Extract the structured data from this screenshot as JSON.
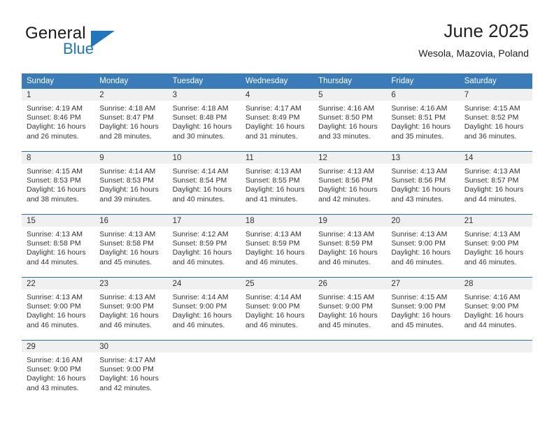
{
  "brand": {
    "name_primary": "General",
    "name_secondary": "Blue",
    "flag_icon": "triangle-flag-icon",
    "accent_color": "#1f76bc"
  },
  "header": {
    "title": "June 2025",
    "location": "Wesola, Mazovia, Poland"
  },
  "theme": {
    "header_row_background": "#3a7cba",
    "header_row_text": "#ffffff",
    "week_divider_color": "#2c6fb0",
    "daynumber_band_background": "#f0f0f0",
    "cell_background": "#ffffff",
    "body_text": "#333333"
  },
  "weekday_headers": [
    "Sunday",
    "Monday",
    "Tuesday",
    "Wednesday",
    "Thursday",
    "Friday",
    "Saturday"
  ],
  "labels": {
    "sunrise_prefix": "Sunrise:",
    "sunset_prefix": "Sunset:",
    "daylight_prefix": "Daylight:"
  },
  "weeks": [
    [
      {
        "day": "1",
        "sunrise": "Sunrise: 4:19 AM",
        "sunset": "Sunset: 8:46 PM",
        "daylight": "Daylight: 16 hours and 26 minutes."
      },
      {
        "day": "2",
        "sunrise": "Sunrise: 4:18 AM",
        "sunset": "Sunset: 8:47 PM",
        "daylight": "Daylight: 16 hours and 28 minutes."
      },
      {
        "day": "3",
        "sunrise": "Sunrise: 4:18 AM",
        "sunset": "Sunset: 8:48 PM",
        "daylight": "Daylight: 16 hours and 30 minutes."
      },
      {
        "day": "4",
        "sunrise": "Sunrise: 4:17 AM",
        "sunset": "Sunset: 8:49 PM",
        "daylight": "Daylight: 16 hours and 31 minutes."
      },
      {
        "day": "5",
        "sunrise": "Sunrise: 4:16 AM",
        "sunset": "Sunset: 8:50 PM",
        "daylight": "Daylight: 16 hours and 33 minutes."
      },
      {
        "day": "6",
        "sunrise": "Sunrise: 4:16 AM",
        "sunset": "Sunset: 8:51 PM",
        "daylight": "Daylight: 16 hours and 35 minutes."
      },
      {
        "day": "7",
        "sunrise": "Sunrise: 4:15 AM",
        "sunset": "Sunset: 8:52 PM",
        "daylight": "Daylight: 16 hours and 36 minutes."
      }
    ],
    [
      {
        "day": "8",
        "sunrise": "Sunrise: 4:15 AM",
        "sunset": "Sunset: 8:53 PM",
        "daylight": "Daylight: 16 hours and 38 minutes."
      },
      {
        "day": "9",
        "sunrise": "Sunrise: 4:14 AM",
        "sunset": "Sunset: 8:53 PM",
        "daylight": "Daylight: 16 hours and 39 minutes."
      },
      {
        "day": "10",
        "sunrise": "Sunrise: 4:14 AM",
        "sunset": "Sunset: 8:54 PM",
        "daylight": "Daylight: 16 hours and 40 minutes."
      },
      {
        "day": "11",
        "sunrise": "Sunrise: 4:13 AM",
        "sunset": "Sunset: 8:55 PM",
        "daylight": "Daylight: 16 hours and 41 minutes."
      },
      {
        "day": "12",
        "sunrise": "Sunrise: 4:13 AM",
        "sunset": "Sunset: 8:56 PM",
        "daylight": "Daylight: 16 hours and 42 minutes."
      },
      {
        "day": "13",
        "sunrise": "Sunrise: 4:13 AM",
        "sunset": "Sunset: 8:56 PM",
        "daylight": "Daylight: 16 hours and 43 minutes."
      },
      {
        "day": "14",
        "sunrise": "Sunrise: 4:13 AM",
        "sunset": "Sunset: 8:57 PM",
        "daylight": "Daylight: 16 hours and 44 minutes."
      }
    ],
    [
      {
        "day": "15",
        "sunrise": "Sunrise: 4:13 AM",
        "sunset": "Sunset: 8:58 PM",
        "daylight": "Daylight: 16 hours and 44 minutes."
      },
      {
        "day": "16",
        "sunrise": "Sunrise: 4:13 AM",
        "sunset": "Sunset: 8:58 PM",
        "daylight": "Daylight: 16 hours and 45 minutes."
      },
      {
        "day": "17",
        "sunrise": "Sunrise: 4:12 AM",
        "sunset": "Sunset: 8:59 PM",
        "daylight": "Daylight: 16 hours and 46 minutes."
      },
      {
        "day": "18",
        "sunrise": "Sunrise: 4:13 AM",
        "sunset": "Sunset: 8:59 PM",
        "daylight": "Daylight: 16 hours and 46 minutes."
      },
      {
        "day": "19",
        "sunrise": "Sunrise: 4:13 AM",
        "sunset": "Sunset: 8:59 PM",
        "daylight": "Daylight: 16 hours and 46 minutes."
      },
      {
        "day": "20",
        "sunrise": "Sunrise: 4:13 AM",
        "sunset": "Sunset: 9:00 PM",
        "daylight": "Daylight: 16 hours and 46 minutes."
      },
      {
        "day": "21",
        "sunrise": "Sunrise: 4:13 AM",
        "sunset": "Sunset: 9:00 PM",
        "daylight": "Daylight: 16 hours and 46 minutes."
      }
    ],
    [
      {
        "day": "22",
        "sunrise": "Sunrise: 4:13 AM",
        "sunset": "Sunset: 9:00 PM",
        "daylight": "Daylight: 16 hours and 46 minutes."
      },
      {
        "day": "23",
        "sunrise": "Sunrise: 4:13 AM",
        "sunset": "Sunset: 9:00 PM",
        "daylight": "Daylight: 16 hours and 46 minutes."
      },
      {
        "day": "24",
        "sunrise": "Sunrise: 4:14 AM",
        "sunset": "Sunset: 9:00 PM",
        "daylight": "Daylight: 16 hours and 46 minutes."
      },
      {
        "day": "25",
        "sunrise": "Sunrise: 4:14 AM",
        "sunset": "Sunset: 9:00 PM",
        "daylight": "Daylight: 16 hours and 46 minutes."
      },
      {
        "day": "26",
        "sunrise": "Sunrise: 4:15 AM",
        "sunset": "Sunset: 9:00 PM",
        "daylight": "Daylight: 16 hours and 45 minutes."
      },
      {
        "day": "27",
        "sunrise": "Sunrise: 4:15 AM",
        "sunset": "Sunset: 9:00 PM",
        "daylight": "Daylight: 16 hours and 45 minutes."
      },
      {
        "day": "28",
        "sunrise": "Sunrise: 4:16 AM",
        "sunset": "Sunset: 9:00 PM",
        "daylight": "Daylight: 16 hours and 44 minutes."
      }
    ],
    [
      {
        "day": "29",
        "sunrise": "Sunrise: 4:16 AM",
        "sunset": "Sunset: 9:00 PM",
        "daylight": "Daylight: 16 hours and 43 minutes."
      },
      {
        "day": "30",
        "sunrise": "Sunrise: 4:17 AM",
        "sunset": "Sunset: 9:00 PM",
        "daylight": "Daylight: 16 hours and 42 minutes."
      },
      {
        "day": "",
        "sunrise": "",
        "sunset": "",
        "daylight": ""
      },
      {
        "day": "",
        "sunrise": "",
        "sunset": "",
        "daylight": ""
      },
      {
        "day": "",
        "sunrise": "",
        "sunset": "",
        "daylight": ""
      },
      {
        "day": "",
        "sunrise": "",
        "sunset": "",
        "daylight": ""
      },
      {
        "day": "",
        "sunrise": "",
        "sunset": "",
        "daylight": ""
      }
    ]
  ]
}
